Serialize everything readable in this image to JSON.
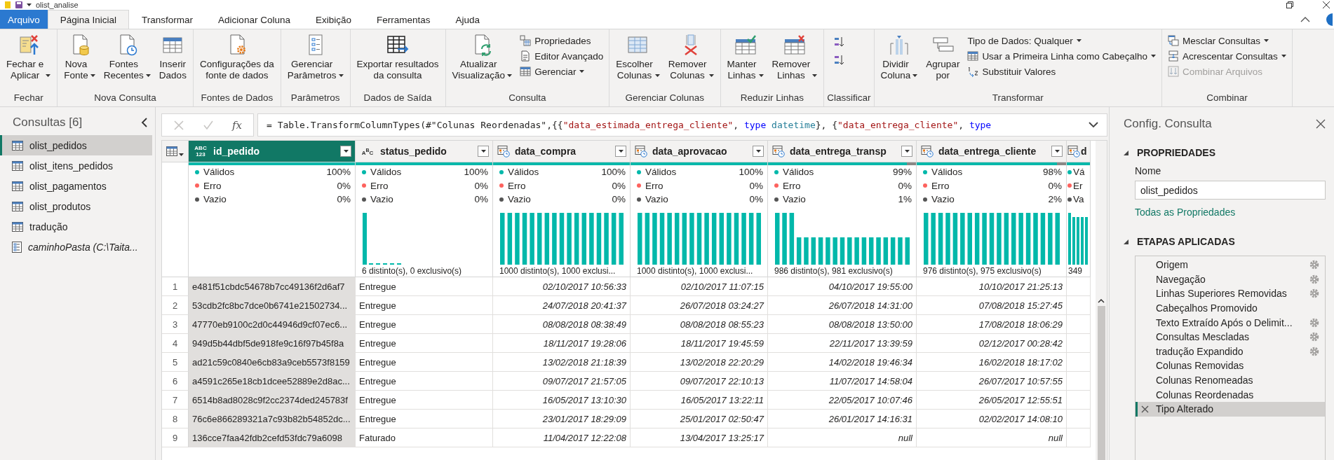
{
  "window": {
    "title": "olist_analise"
  },
  "tabs": [
    {
      "label": "Arquivo",
      "kind": "file",
      "selected": false
    },
    {
      "label": "Página Inicial",
      "kind": "tab",
      "selected": true
    },
    {
      "label": "Transformar",
      "kind": "tab",
      "selected": false
    },
    {
      "label": "Adicionar Coluna",
      "kind": "tab",
      "selected": false
    },
    {
      "label": "Exibição",
      "kind": "tab",
      "selected": false
    },
    {
      "label": "Ferramentas",
      "kind": "tab",
      "selected": false
    },
    {
      "label": "Ajuda",
      "kind": "tab",
      "selected": false
    }
  ],
  "ribbon": {
    "groups": [
      {
        "label": "Fechar",
        "items": [
          {
            "kind": "large",
            "lines": [
              "Fechar e",
              "Aplicar"
            ],
            "dropdown": true
          }
        ]
      },
      {
        "label": "Nova Consulta",
        "items": [
          {
            "kind": "large",
            "lines": [
              "Nova",
              "Fonte"
            ],
            "dropdown": true
          },
          {
            "kind": "large",
            "lines": [
              "Fontes",
              "Recentes"
            ],
            "dropdown": true
          },
          {
            "kind": "large",
            "lines": [
              "Inserir",
              "Dados"
            ],
            "dropdown": false
          }
        ]
      },
      {
        "label": "Fontes de Dados",
        "items": [
          {
            "kind": "large",
            "lines": [
              "Configurações da",
              "fonte de dados"
            ],
            "dropdown": false
          }
        ]
      },
      {
        "label": "Parâmetros",
        "items": [
          {
            "kind": "large",
            "lines": [
              "Gerenciar",
              "Parâmetros"
            ],
            "dropdown": true
          }
        ]
      },
      {
        "label": "Dados de Saída",
        "items": [
          {
            "kind": "large",
            "lines": [
              "Exportar resultados",
              "da consulta"
            ],
            "dropdown": false
          }
        ]
      },
      {
        "label": "Consulta",
        "items": [
          {
            "kind": "large",
            "lines": [
              "Atualizar",
              "Visualização"
            ],
            "dropdown": true
          },
          {
            "kind": "small",
            "label": "Propriedades",
            "dropdown": false
          },
          {
            "kind": "small",
            "label": "Editor Avançado",
            "dropdown": false
          },
          {
            "kind": "small",
            "label": "Gerenciar",
            "dropdown": true
          }
        ]
      },
      {
        "label": "Gerenciar Colunas",
        "items": [
          {
            "kind": "large",
            "lines": [
              "Escolher",
              "Colunas"
            ],
            "dropdown": true
          },
          {
            "kind": "large",
            "lines": [
              "Remover",
              "Colunas"
            ],
            "dropdown": true
          }
        ]
      },
      {
        "label": "Reduzir Linhas",
        "items": [
          {
            "kind": "large",
            "lines": [
              "Manter",
              "Linhas"
            ],
            "dropdown": true
          },
          {
            "kind": "large",
            "lines": [
              "Remover",
              "Linhas"
            ],
            "dropdown": true
          }
        ]
      },
      {
        "label": "Classificar",
        "items": [
          {
            "kind": "icon",
            "dropdown": false
          },
          {
            "kind": "icon",
            "dropdown": false
          }
        ]
      },
      {
        "label": "Transformar",
        "items": [
          {
            "kind": "large",
            "lines": [
              "Dividir",
              "Coluna"
            ],
            "dropdown": true
          },
          {
            "kind": "large",
            "lines": [
              "Agrupar",
              "por"
            ],
            "dropdown": false
          },
          {
            "kind": "small",
            "label": "Tipo de Dados: Qualquer",
            "dropdown": true
          },
          {
            "kind": "small",
            "label": "Usar a Primeira Linha como Cabeçalho",
            "dropdown": true
          },
          {
            "kind": "small",
            "label": "Substituir Valores",
            "dropdown": false
          }
        ]
      },
      {
        "label": "Combinar",
        "items": [
          {
            "kind": "small",
            "label": "Mesclar Consultas",
            "dropdown": true,
            "disabled": false
          },
          {
            "kind": "small",
            "label": "Acrescentar Consultas",
            "dropdown": true,
            "disabled": false
          },
          {
            "kind": "small",
            "label": "Combinar Arquivos",
            "dropdown": false,
            "disabled": true
          }
        ]
      }
    ]
  },
  "queries": {
    "title": "Consultas [6]",
    "items": [
      {
        "label": "olist_pedidos",
        "kind": "table",
        "selected": true
      },
      {
        "label": "olist_itens_pedidos",
        "kind": "table",
        "selected": false
      },
      {
        "label": "olist_pagamentos",
        "kind": "table",
        "selected": false
      },
      {
        "label": "olist_produtos",
        "kind": "table",
        "selected": false
      },
      {
        "label": "tradução",
        "kind": "table",
        "selected": false
      },
      {
        "label": "caminhoPasta (C:\\Taita...",
        "kind": "parameter",
        "selected": false
      }
    ]
  },
  "formula_bar": {
    "fx": "fx",
    "tokens": [
      {
        "text": "= Table.TransformColumnTypes(#\"Colunas Reordenadas\",{{",
        "kind": "plain"
      },
      {
        "text": "\"data_estimada_entrega_cliente\"",
        "kind": "string"
      },
      {
        "text": ", ",
        "kind": "plain"
      },
      {
        "text": "type",
        "kind": "keyword"
      },
      {
        "text": " datetime",
        "kind": "type"
      },
      {
        "text": "}, {",
        "kind": "plain"
      },
      {
        "text": "\"data_entrega_cliente\"",
        "kind": "string"
      },
      {
        "text": ", ",
        "kind": "plain"
      },
      {
        "text": "type",
        "kind": "keyword"
      }
    ]
  },
  "table": {
    "columns": [
      {
        "name": "id_pedido",
        "kind": "any",
        "type_text": "ABC 123",
        "selected": true,
        "level": 1,
        "stats": [
          {
            "label": "Válidos",
            "value": "100%",
            "color": "#01b8aa"
          },
          {
            "label": "Erro",
            "value": "0%",
            "color": "#fd625e"
          },
          {
            "label": "Vazio",
            "value": "0%",
            "color": "#555555"
          }
        ]
      },
      {
        "name": "status_pedido",
        "kind": "text",
        "type_text": "A$^{B}$C",
        "selected": false,
        "level": 1,
        "histogram": {
          "kind": "spike"
        },
        "stats": [
          {
            "label": "Válidos",
            "value": "100%",
            "color": "#01b8aa"
          },
          {
            "label": "Erro",
            "value": "0%",
            "color": "#fd625e"
          },
          {
            "label": "Vazio",
            "value": "0%",
            "color": "#555555"
          }
        ],
        "summary": "6 distinto(s), 0 exclusivo(s)"
      },
      {
        "name": "data_compra",
        "kind": "datetime",
        "selected": false,
        "level": 1,
        "histogram": {
          "kind": "uniform"
        },
        "stats": [
          {
            "label": "Válidos",
            "value": "100%",
            "color": "#01b8aa"
          },
          {
            "label": "Erro",
            "value": "0%",
            "color": "#fd625e"
          },
          {
            "label": "Vazio",
            "value": "0%",
            "color": "#555555"
          }
        ],
        "summary": "1000 distinto(s), 1000 exclusi..."
      },
      {
        "name": "data_aprovacao",
        "kind": "datetime",
        "selected": false,
        "level": 1,
        "histogram": {
          "kind": "uniform"
        },
        "stats": [
          {
            "label": "Válidos",
            "value": "100%",
            "color": "#01b8aa"
          },
          {
            "label": "Erro",
            "value": "0%",
            "color": "#fd625e"
          },
          {
            "label": "Vazio",
            "value": "0%",
            "color": "#555555"
          }
        ],
        "summary": "1000 distinto(s), 1000 exclusi..."
      },
      {
        "name": "data_entrega_transp",
        "kind": "datetime",
        "selected": false,
        "level": 0.94,
        "histogram": {
          "kind": "step"
        },
        "stats": [
          {
            "label": "Válidos",
            "value": "99%",
            "color": "#01b8aa"
          },
          {
            "label": "Erro",
            "value": "0%",
            "color": "#fd625e"
          },
          {
            "label": "Vazio",
            "value": "1%",
            "color": "#555555"
          }
        ],
        "summary": "986 distinto(s), 981 exclusivo(s)"
      },
      {
        "name": "data_entrega_cliente",
        "kind": "datetime",
        "selected": false,
        "level": 0.94,
        "histogram": {
          "kind": "uniform"
        },
        "stats": [
          {
            "label": "Válidos",
            "value": "98%",
            "color": "#01b8aa"
          },
          {
            "label": "Erro",
            "value": "0%",
            "color": "#fd625e"
          },
          {
            "label": "Vazio",
            "value": "2%",
            "color": "#555555"
          }
        ],
        "summary": "976 distinto(s), 975 exclusivo(s)"
      },
      {
        "name": "d",
        "kind": "datetime",
        "selected": false,
        "level": 1,
        "histogram": {
          "kind": "slight_step"
        },
        "stats": [
          {
            "label": "Vá",
            "color": "#01b8aa"
          },
          {
            "label": "Er",
            "color": "#fd625e"
          },
          {
            "label": "Va",
            "color": "#555555"
          }
        ],
        "summary": "349"
      }
    ],
    "rows": [
      {
        "number": "1",
        "cells": [
          "e481f51cbdc54678b7cc49136f2d6af7",
          "Entregue",
          "02/10/2017 10:56:33",
          "02/10/2017 11:07:15",
          "04/10/2017 19:55:00",
          "10/10/2017 21:25:13"
        ]
      },
      {
        "number": "2",
        "cells": [
          "53cdb2fc8bc7dce0b6741e21502734...",
          "Entregue",
          "24/07/2018 20:41:37",
          "26/07/2018 03:24:27",
          "26/07/2018 14:31:00",
          "07/08/2018 15:27:45"
        ]
      },
      {
        "number": "3",
        "cells": [
          "47770eb9100c2d0c44946d9cf07ec6...",
          "Entregue",
          "08/08/2018 08:38:49",
          "08/08/2018 08:55:23",
          "08/08/2018 13:50:00",
          "17/08/2018 18:06:29"
        ]
      },
      {
        "number": "4",
        "cells": [
          "949d5b44dbf5de918fe9c16f97b45f8a",
          "Entregue",
          "18/11/2017 19:28:06",
          "18/11/2017 19:45:59",
          "22/11/2017 13:39:59",
          "02/12/2017 00:28:42"
        ]
      },
      {
        "number": "5",
        "cells": [
          "ad21c59c0840e6cb83a9ceb5573f8159",
          "Entregue",
          "13/02/2018 21:18:39",
          "13/02/2018 22:20:29",
          "14/02/2018 19:46:34",
          "16/02/2018 18:17:02"
        ]
      },
      {
        "number": "6",
        "cells": [
          "a4591c265e18cb1dcee52889e2d8ac...",
          "Entregue",
          "09/07/2017 21:57:05",
          "09/07/2017 22:10:13",
          "11/07/2017 14:58:04",
          "26/07/2017 10:57:55"
        ]
      },
      {
        "number": "7",
        "cells": [
          "6514b8ad8028c9f2cc2374ded245783f",
          "Entregue",
          "16/05/2017 13:10:30",
          "16/05/2017 13:22:11",
          "22/05/2017 10:07:46",
          "26/05/2017 12:55:51"
        ]
      },
      {
        "number": "8",
        "cells": [
          "76c6e866289321a7c93b82b54852dc...",
          "Entregue",
          "23/01/2017 18:29:09",
          "25/01/2017 02:50:47",
          "26/01/2017 14:16:31",
          "02/02/2017 14:08:10"
        ]
      },
      {
        "number": "9",
        "cells": [
          "136cce7faa42fdb2cefd53fdc79a6098",
          "Faturado",
          "11/04/2017 12:22:08",
          "13/04/2017 13:25:17",
          "null",
          "null"
        ]
      }
    ]
  },
  "settings": {
    "title": "Config. Consulta",
    "properties": {
      "heading": "PROPRIEDADES",
      "name_label": "Nome",
      "name_value": "olist_pedidos",
      "link": "Todas as Propriedades"
    },
    "steps_heading": "ETAPAS APLICADAS",
    "steps": [
      {
        "label": "Origem",
        "has_settings": true,
        "selected": false
      },
      {
        "label": "Navegação",
        "has_settings": true,
        "selected": false
      },
      {
        "label": "Linhas Superiores Removidas",
        "has_settings": true,
        "selected": false
      },
      {
        "label": "Cabeçalhos Promovido",
        "has_settings": false,
        "selected": false
      },
      {
        "label": "Texto Extraído Após o Delimit...",
        "has_settings": true,
        "selected": false
      },
      {
        "label": "Consultas Mescladas",
        "has_settings": true,
        "selected": false
      },
      {
        "label": "tradução Expandido",
        "has_settings": true,
        "selected": false
      },
      {
        "label": "Colunas Removidas",
        "has_settings": false,
        "selected": false
      },
      {
        "label": "Colunas Renomeadas",
        "has_settings": false,
        "selected": false
      },
      {
        "label": "Colunas Reordenadas",
        "has_settings": false,
        "selected": false
      },
      {
        "label": "Tipo Alterado",
        "has_settings": false,
        "selected": true
      }
    ]
  }
}
